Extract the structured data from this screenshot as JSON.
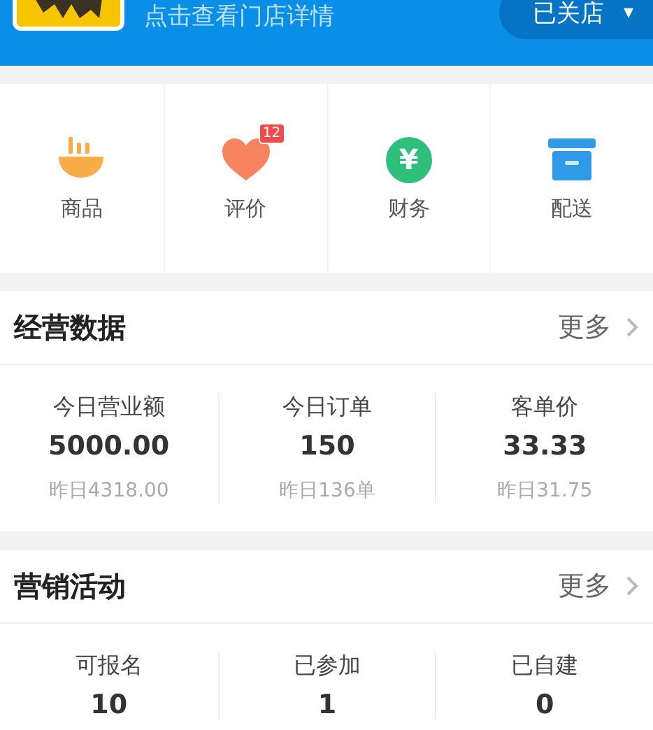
{
  "header": {
    "subtitle": "点击查看门店详情",
    "status": {
      "label": "已关店",
      "caret": "▾",
      "open": false
    }
  },
  "shortcuts": [
    {
      "kind": "bowl",
      "label": "商品"
    },
    {
      "kind": "heart",
      "label": "评价",
      "badge": "12"
    },
    {
      "kind": "yuan",
      "label": "财务",
      "symbol": "¥"
    },
    {
      "kind": "box",
      "label": "配送"
    }
  ],
  "sections": [
    {
      "title": "经营数据",
      "more": "更多",
      "stats": [
        {
          "label": "今日营业额",
          "value": "5000.00",
          "previous": "昨日4318.00"
        },
        {
          "label": "今日订单",
          "value": "150",
          "previous": "昨日136单"
        },
        {
          "label": "客单价",
          "value": "33.33",
          "previous": "昨日31.75"
        }
      ]
    },
    {
      "title": "营销活动",
      "more": "更多",
      "stats": [
        {
          "label": "可报名",
          "value": "10"
        },
        {
          "label": "已参加",
          "value": "1"
        },
        {
          "label": "已自建",
          "value": "0"
        }
      ]
    }
  ]
}
